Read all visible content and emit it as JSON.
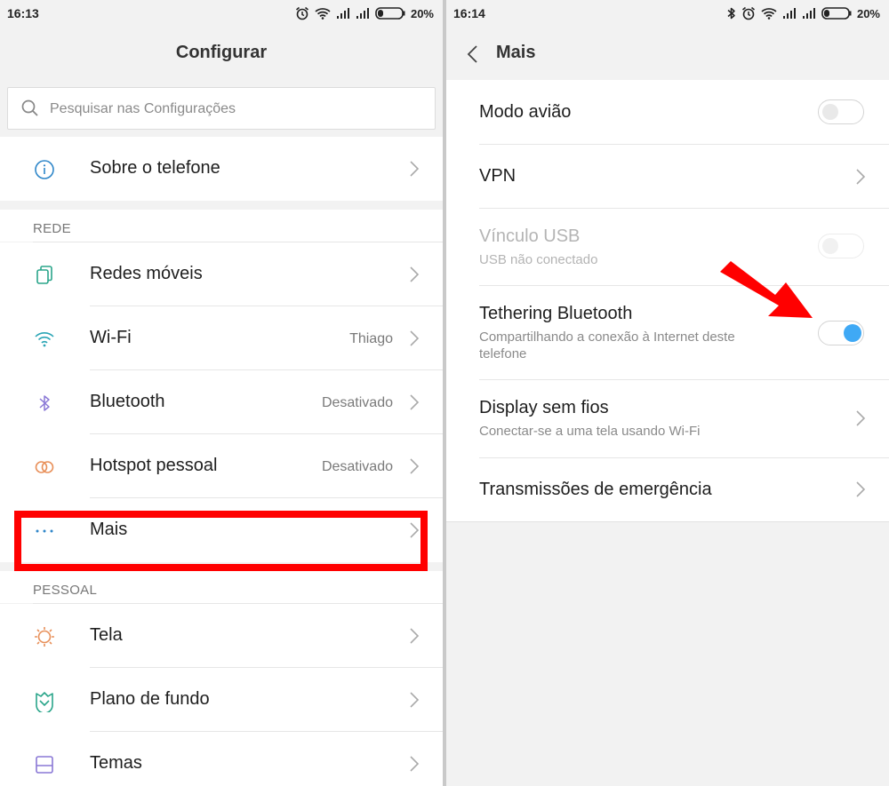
{
  "left": {
    "status": {
      "time": "16:13",
      "battery": "20%"
    },
    "title": "Configurar",
    "search_placeholder": "Pesquisar nas Configurações",
    "about": {
      "label": "Sobre o telefone"
    },
    "section_network": "REDE",
    "network_items": [
      {
        "label": "Redes móveis",
        "value": "",
        "icon": "sim-cards-icon"
      },
      {
        "label": "Wi-Fi",
        "value": "Thiago",
        "icon": "wifi-icon"
      },
      {
        "label": "Bluetooth",
        "value": "Desativado",
        "icon": "bluetooth-icon"
      },
      {
        "label": "Hotspot pessoal",
        "value": "Desativado",
        "icon": "hotspot-icon"
      },
      {
        "label": "Mais",
        "value": "",
        "icon": "more-icon"
      }
    ],
    "section_personal": "PESSOAL",
    "personal_items": [
      {
        "label": "Tela",
        "icon": "brightness-icon"
      },
      {
        "label": "Plano de fundo",
        "icon": "wallpaper-icon"
      },
      {
        "label": "Temas",
        "icon": "themes-icon"
      }
    ]
  },
  "right": {
    "status": {
      "time": "16:14",
      "battery": "20%"
    },
    "title": "Mais",
    "items": [
      {
        "label": "Modo avião",
        "sub": "",
        "control": "toggle",
        "on": false
      },
      {
        "label": "VPN",
        "sub": "",
        "control": "chevron"
      },
      {
        "label": "Vínculo USB",
        "sub": "USB não conectado",
        "control": "toggle",
        "on": false,
        "disabled": true
      },
      {
        "label": "Tethering Bluetooth",
        "sub": "Compartilhando a conexão à Internet deste telefone",
        "control": "toggle",
        "on": true
      },
      {
        "label": "Display sem fios",
        "sub": "Conectar-se a uma tela usando Wi-Fi",
        "control": "chevron"
      },
      {
        "label": "Transmissões de emergência",
        "sub": "",
        "control": "chevron"
      }
    ]
  },
  "colors": {
    "accent": "#3fa9f5",
    "highlight": "#ff0000"
  }
}
